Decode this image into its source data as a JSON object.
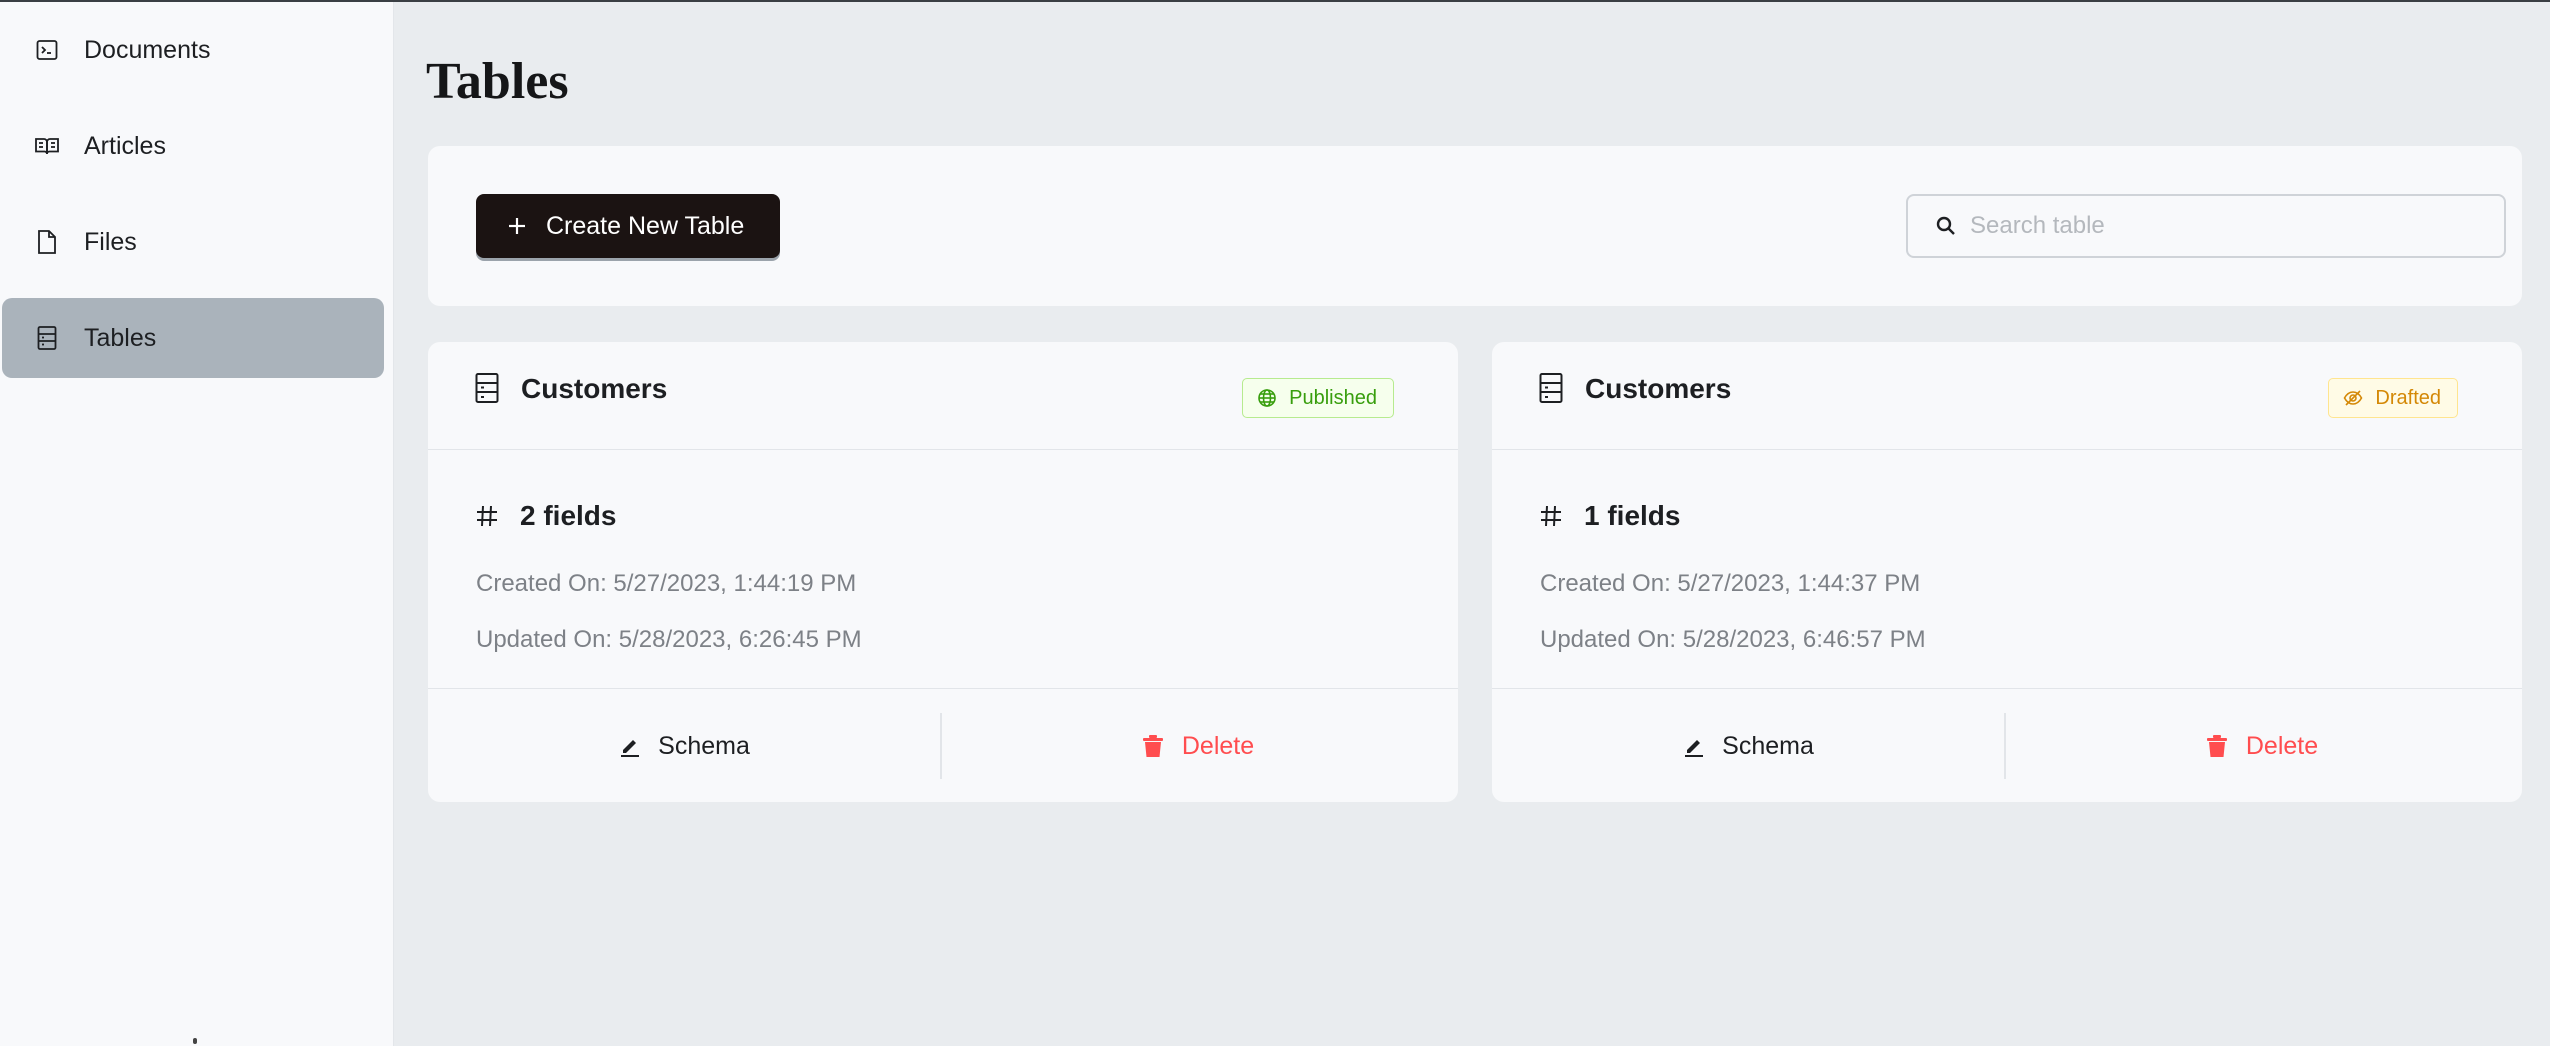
{
  "sidebar": {
    "items": [
      {
        "label": "Documents",
        "icon": "terminal-icon",
        "active": false
      },
      {
        "label": "Articles",
        "icon": "book-open-icon",
        "active": false
      },
      {
        "label": "Files",
        "icon": "file-icon",
        "active": false
      },
      {
        "label": "Tables",
        "icon": "table-icon",
        "active": true
      }
    ]
  },
  "page": {
    "title": "Tables"
  },
  "toolbar": {
    "create_label": "Create New Table",
    "search_placeholder": "Search table",
    "search_value": ""
  },
  "cards": [
    {
      "title": "Customers",
      "status": "Published",
      "fields": "2 fields",
      "created": "Created On: 5/27/2023, 1:44:19 PM",
      "updated": "Updated On: 5/28/2023, 6:26:45 PM",
      "schema_label": "Schema",
      "delete_label": "Delete"
    },
    {
      "title": "Customers",
      "status": "Drafted",
      "fields": "1 fields",
      "created": "Created On: 5/27/2023, 1:44:37 PM",
      "updated": "Updated On: 5/28/2023, 6:46:57 PM",
      "schema_label": "Schema",
      "delete_label": "Delete"
    }
  ],
  "colors": {
    "active_nav": "#aab3bb",
    "primary_button": "#1b1312",
    "published": "#389e0d",
    "drafted": "#d48806",
    "danger": "#ff4d4f"
  }
}
